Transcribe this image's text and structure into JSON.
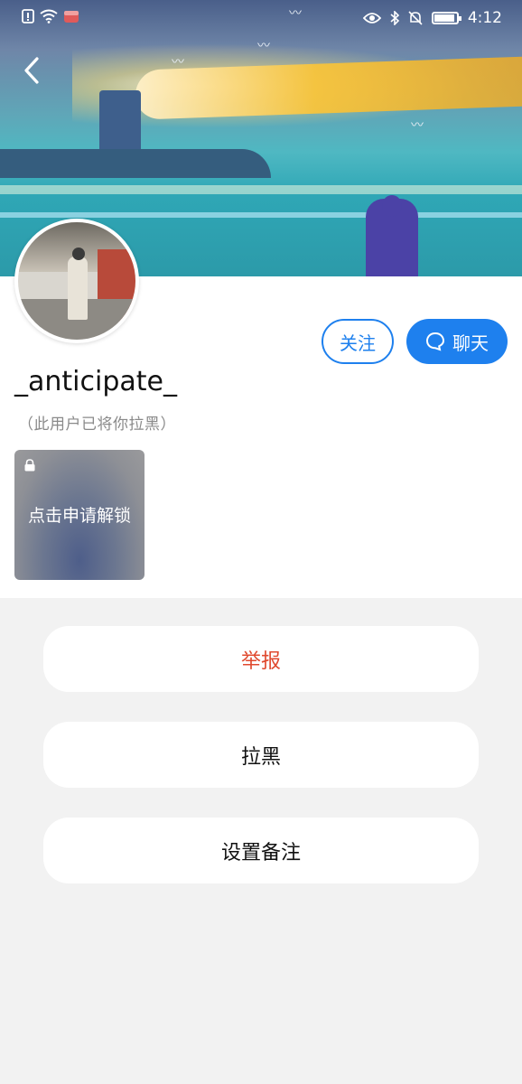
{
  "status_bar": {
    "time": "4:12",
    "icons_left": [
      "alert-icon",
      "wifi-icon",
      "app-notification-icon"
    ],
    "icons_right": [
      "eye-icon",
      "bluetooth-icon",
      "mute-icon",
      "battery-icon"
    ]
  },
  "header": {
    "back_icon": "chevron-left-icon"
  },
  "profile": {
    "username": "_anticipate_",
    "note": "（此用户已将你拉黑）",
    "follow_label": "关注",
    "chat_label": "聊天"
  },
  "locked_content": {
    "label": "点击申请解锁",
    "icon": "lock-icon"
  },
  "actions": [
    {
      "label": "举报",
      "color": "#e04a2f"
    },
    {
      "label": "拉黑",
      "color": "#111111"
    },
    {
      "label": "设置备注",
      "color": "#111111"
    }
  ],
  "colors": {
    "accent": "#1e80ee",
    "danger": "#e04a2f",
    "background": "#f2f2f2"
  }
}
